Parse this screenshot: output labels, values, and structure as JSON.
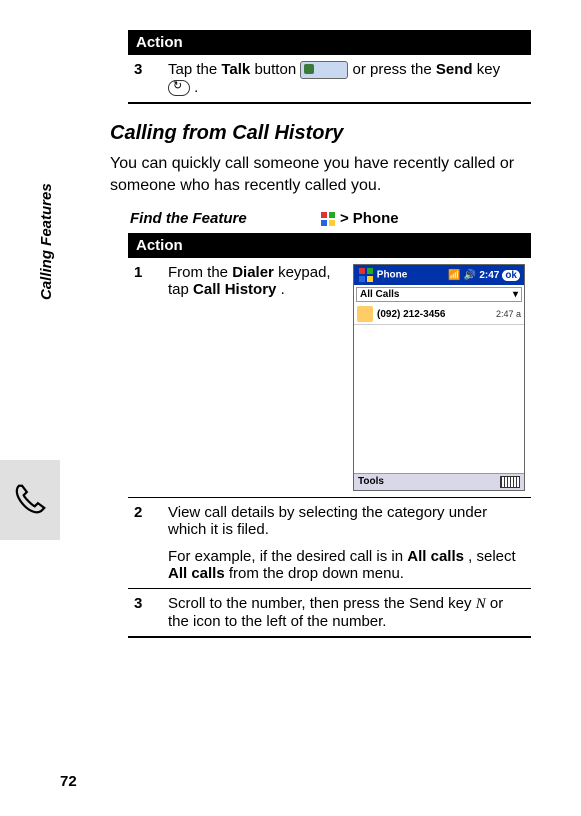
{
  "sidebar": {
    "label": "Calling Features"
  },
  "table1": {
    "header": "Action",
    "step3": {
      "num": "3",
      "pre": "Tap the ",
      "talk": "Talk",
      "mid1": " button  ",
      "mid2": "  or press the ",
      "send": "Send",
      "post": " key ",
      "period": "."
    }
  },
  "heading": "Calling from Call History",
  "intro": "You can quickly call someone you have recently called or someone who has recently called you.",
  "feature": {
    "title": "Find the Feature",
    "gt": ">",
    "phone": "Phone"
  },
  "table2": {
    "header": "Action",
    "step1": {
      "num": "1",
      "pre": "From the ",
      "dialer": "Dialer",
      "mid": " keypad, tap ",
      "ch": "Call History",
      "post": "."
    },
    "step2": {
      "num": "2",
      "line1_a": "View call details by selecting the category under which it is filed.",
      "line2_a": "For example, if the desired call is in ",
      "all1": "All calls",
      "line2_b": ", select ",
      "all2": "All calls",
      "line2_c": " from the drop down menu."
    },
    "step3": {
      "num": "3",
      "a": "Scroll to the number, then press the Send key ",
      "n": "N",
      "b": " or the icon to the left of the number."
    }
  },
  "phone_mock": {
    "title": "Phone",
    "time": "2:47",
    "ok": "ok",
    "dropdown": "All Calls",
    "entry_num": "(092) 212-3456",
    "entry_time": "2:47 a",
    "tools": "Tools"
  },
  "page_number": "72"
}
